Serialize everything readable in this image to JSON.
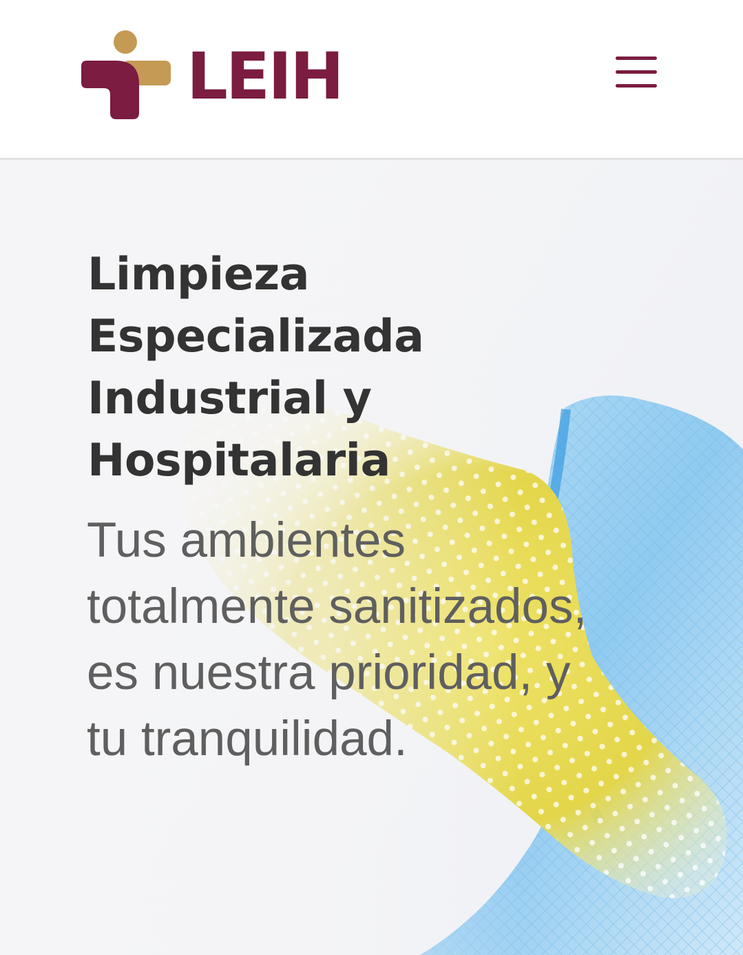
{
  "header": {
    "brand_name": "LEIH",
    "logo_icon": "leih-cross-logo-icon",
    "menu_icon": "hamburger-menu-icon",
    "colors": {
      "brand_maroon": "#7b1c40",
      "brand_gold": "#c49a55",
      "divider": "#e2e2e2"
    }
  },
  "hero": {
    "title": "Limpieza Especializada Industrial y Hospitalaria",
    "subtitle": "Tus ambientes totalmente sanitizados, es nuestra prioridad, y tu tranquilidad.",
    "image_subject": "yellow-glove-and-blue-cloth-icon",
    "colors": {
      "title": "#333333",
      "subtitle": "#5f5f5f",
      "glove": "#e3d64a",
      "cloth": "#5fb4e6"
    }
  }
}
